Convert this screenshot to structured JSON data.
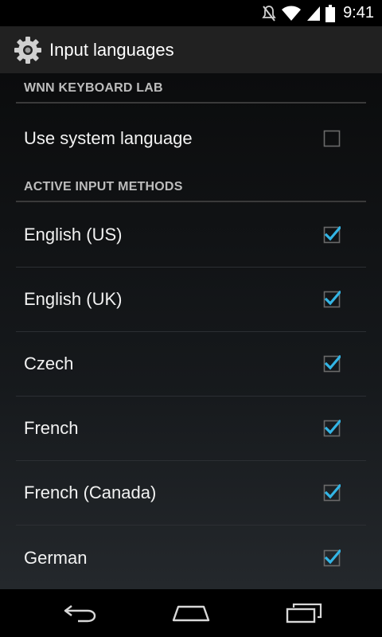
{
  "status_bar": {
    "time": "9:41",
    "icons": [
      "mute-icon",
      "wifi-icon",
      "signal-icon",
      "battery-icon"
    ]
  },
  "action_bar": {
    "icon": "settings-gear-icon",
    "title": "Input languages"
  },
  "sections": {
    "keyboard_lab": {
      "header": "WNN KEYBOARD LAB",
      "system_language": {
        "label": "Use system language",
        "checked": false
      }
    },
    "active_input_methods": {
      "header": "ACTIVE INPUT METHODS",
      "items": [
        {
          "label": "English (US)",
          "checked": true
        },
        {
          "label": "English (UK)",
          "checked": true
        },
        {
          "label": "Czech",
          "checked": true
        },
        {
          "label": "French",
          "checked": true
        },
        {
          "label": "French (Canada)",
          "checked": true
        },
        {
          "label": "German",
          "checked": true
        }
      ]
    }
  },
  "navigation": {
    "buttons": [
      "back-icon",
      "home-icon",
      "recent-apps-icon"
    ]
  },
  "colors": {
    "accent": "#33b5e5",
    "action_bar": "#212121",
    "section_text": "#bdbdbd"
  }
}
